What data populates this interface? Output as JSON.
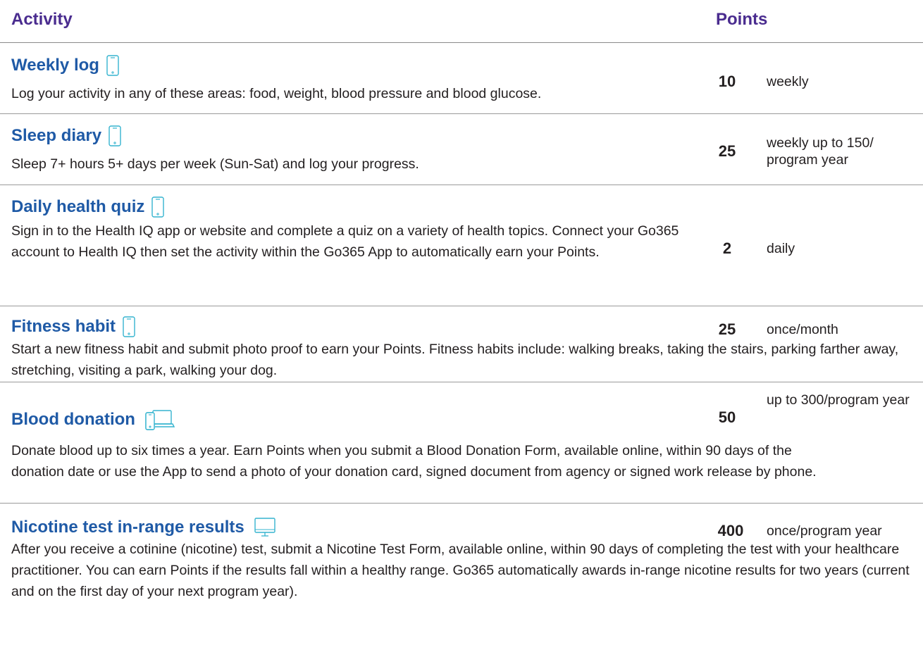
{
  "header": {
    "activity_label": "Activity",
    "points_label": "Points"
  },
  "colors": {
    "header_text": "#4a2c8f",
    "title_text": "#1f5aa6",
    "icon_stroke": "#35b4cf",
    "divider": "#8a8a8a"
  },
  "rows": [
    {
      "title": "Weekly log",
      "icon": "phone-icon",
      "description": "Log your activity in any of these areas: food, weight, blood pressure and blood glucose.",
      "points": "10",
      "frequency": "weekly"
    },
    {
      "title": "Sleep diary",
      "icon": "phone-icon",
      "description": "Sleep 7+ hours 5+ days per week (Sun-Sat) and log your progress.",
      "points": "25",
      "frequency": "weekly up to 150/ program year"
    },
    {
      "title": "Daily health quiz",
      "icon": "phone-icon",
      "description": "Sign in to the Health IQ app or website and complete a quiz on a variety of health topics. Connect your Go365 account to Health IQ then set the activity within the Go365 App to automatically earn your Points.",
      "points": "2",
      "frequency": "daily"
    },
    {
      "title": "Fitness habit",
      "icon": "phone-icon",
      "description": "Start a new fitness habit and submit photo proof to earn your Points. Fitness habits include: walking breaks, taking the stairs, parking farther away, stretching, visiting a park, walking your dog.",
      "points": "25",
      "frequency": "once/month"
    },
    {
      "title": "Blood donation",
      "icon": "phone-and-laptop-icon",
      "description": "Donate blood up to six times a year. Earn Points when you submit a Blood Donation Form, available online, within 90 days of the donation date or use the App to send a photo of your donation card, signed document from agency or signed work release by phone.",
      "points": "50",
      "frequency": "up to 300/program year"
    },
    {
      "title": "Nicotine test in-range results",
      "icon": "desktop-monitor-icon",
      "description": "After you receive a cotinine (nicotine) test, submit a Nicotine Test Form, available online, within 90 days of completing the test with your healthcare practitioner. You can earn Points if the results fall within a healthy range. Go365 automatically awards in-range nicotine results for two years (current and on the first day of your next program year).",
      "points": "400",
      "frequency": "once/program year"
    }
  ]
}
